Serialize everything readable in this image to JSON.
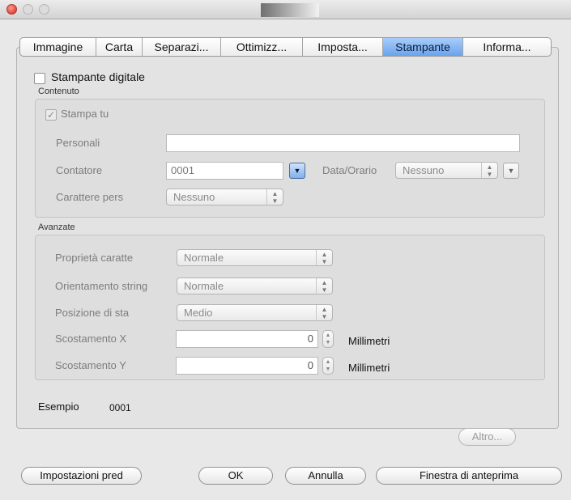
{
  "tabs": [
    {
      "label": "Immagine",
      "active": false
    },
    {
      "label": "Carta",
      "active": false
    },
    {
      "label": "Separazi...",
      "active": false
    },
    {
      "label": "Ottimizz...",
      "active": false
    },
    {
      "label": "Imposta...",
      "active": false
    },
    {
      "label": "Stampante",
      "active": true
    },
    {
      "label": "Informa...",
      "active": false
    }
  ],
  "printer": {
    "digital_printer_label": "Stampante digitale",
    "digital_printer_checked": false
  },
  "content": {
    "section_label": "Contenuto",
    "print_label": "Stampa tu",
    "print_checked": true,
    "personal_label": "Personali",
    "personal_value": "",
    "counter_label": "Contatore",
    "counter_value": "0001",
    "datetime_label": "Data/Orario",
    "datetime_value": "Nessuno",
    "custom_char_label": "Carattere pers",
    "custom_char_value": "Nessuno"
  },
  "advanced": {
    "section_label": "Avanzate",
    "char_property_label": "Proprietà caratte",
    "char_property_value": "Normale",
    "string_orientation_label": "Orientamento string",
    "string_orientation_value": "Normale",
    "print_position_label": "Posizione di sta",
    "print_position_value": "Medio",
    "offset_x_label": "Scostamento X",
    "offset_x_value": "0",
    "offset_x_unit": "Millimetri",
    "offset_y_label": "Scostamento Y",
    "offset_y_value": "0",
    "offset_y_unit": "Millimetri"
  },
  "example": {
    "label": "Esempio",
    "value": "0001"
  },
  "buttons": {
    "more": "Altro...",
    "default_settings": "Impostazioni pred",
    "ok": "OK",
    "cancel": "Annulla",
    "preview_window": "Finestra di anteprima"
  },
  "colors": {
    "active_tab": "#6aa3ec",
    "close_button": "#e2463a"
  }
}
